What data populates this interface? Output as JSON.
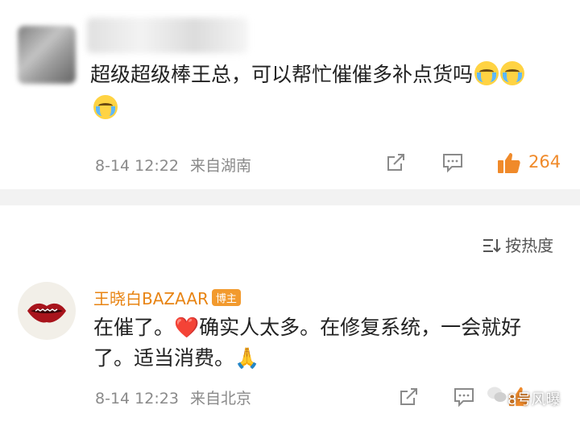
{
  "comment1": {
    "text": "超级超级棒王总，可以帮忙催催多补点货吗",
    "emoji": [
      "crying-emoji",
      "crying-emoji",
      "crying-emoji"
    ],
    "time": "8-14 12:22",
    "source": "来自湖南",
    "like_count": "264"
  },
  "sort": {
    "label": "按热度"
  },
  "comment2": {
    "author": "王晓白BAZAAR",
    "badge": "博主",
    "text_line1": "在催了。❤️确实人太多。在修复系统，一会就好",
    "text_line2": "了。适当消费。🙏",
    "time": "8-14 12:23",
    "source": "来自北京"
  },
  "watermark": {
    "text": "8号风曝"
  },
  "colors": {
    "like_icon": "#f08a2a",
    "author_name": "#e88413",
    "meta_text": "#8a8a8a",
    "divider": "#f2f2f2"
  }
}
